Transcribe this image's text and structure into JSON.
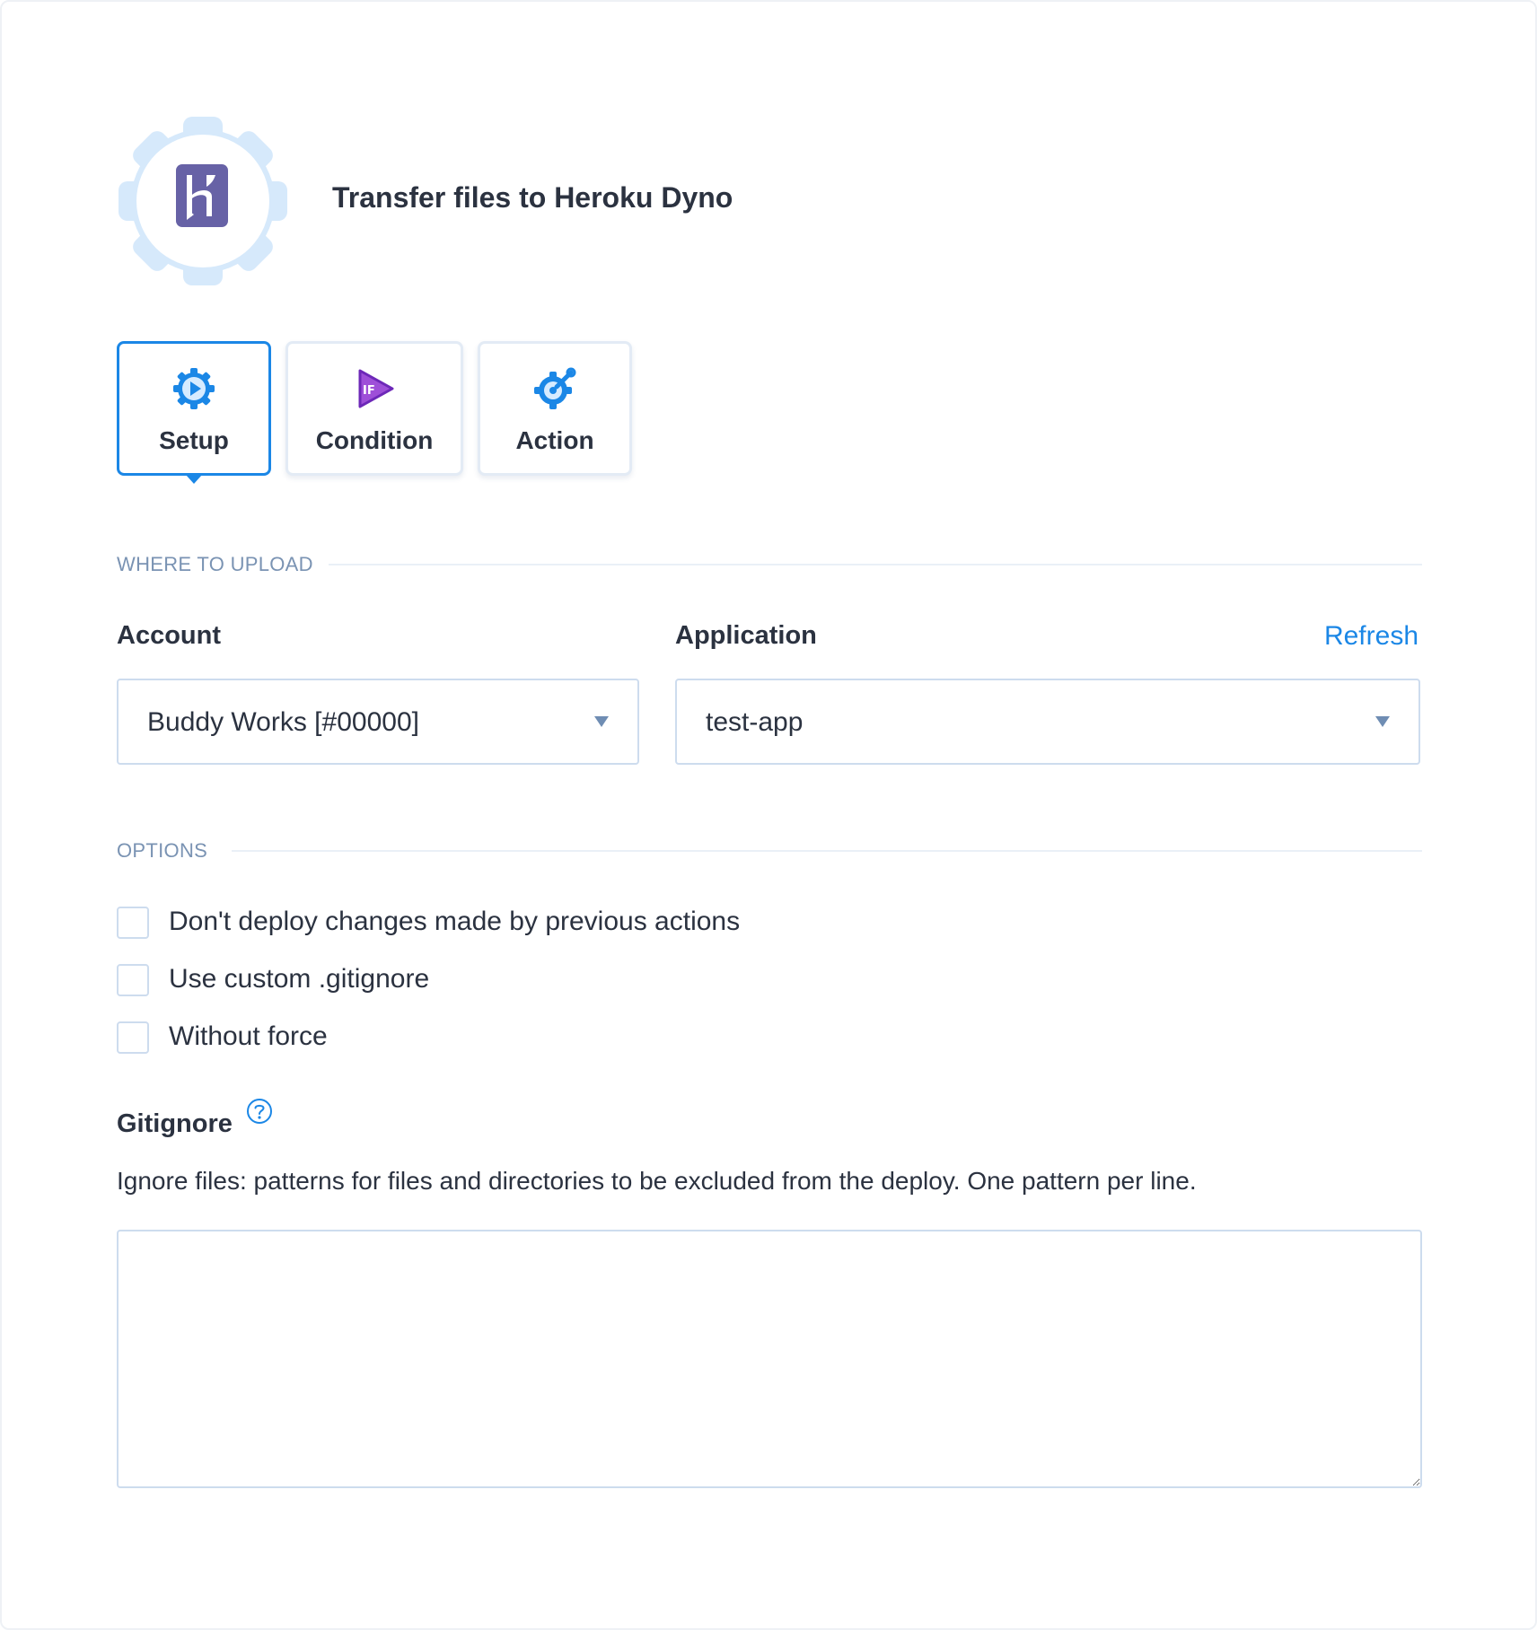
{
  "header": {
    "title": "Transfer files to Heroku Dyno",
    "service_icon": "heroku-logo-icon",
    "colors": {
      "gear": "#d6e9fb",
      "heroku": "#6762a6"
    }
  },
  "tabs": [
    {
      "label": "Setup",
      "icon": "gear-play-icon",
      "active": true
    },
    {
      "label": "Condition",
      "icon": "if-condition-icon",
      "active": false
    },
    {
      "label": "Action",
      "icon": "gear-wrench-icon",
      "active": false
    }
  ],
  "sections": {
    "where_to_upload": "WHERE TO UPLOAD",
    "options": "OPTIONS"
  },
  "fields": {
    "account": {
      "label": "Account",
      "value": "Buddy Works [#00000]"
    },
    "application": {
      "label": "Application",
      "value": "test-app",
      "refresh_label": "Refresh"
    }
  },
  "options": [
    {
      "label": "Don't deploy changes made by previous actions",
      "checked": false
    },
    {
      "label": "Use custom .gitignore",
      "checked": false
    },
    {
      "label": "Without force",
      "checked": false
    }
  ],
  "gitignore": {
    "label": "Gitignore",
    "help_icon": "question-circle-icon",
    "description": "Ignore files: patterns for files and directories to be excluded from the deploy. One pattern per line.",
    "value": ""
  },
  "colors": {
    "accent": "#1b87e6",
    "section_text": "#7a93b3",
    "border": "#cddcee"
  }
}
